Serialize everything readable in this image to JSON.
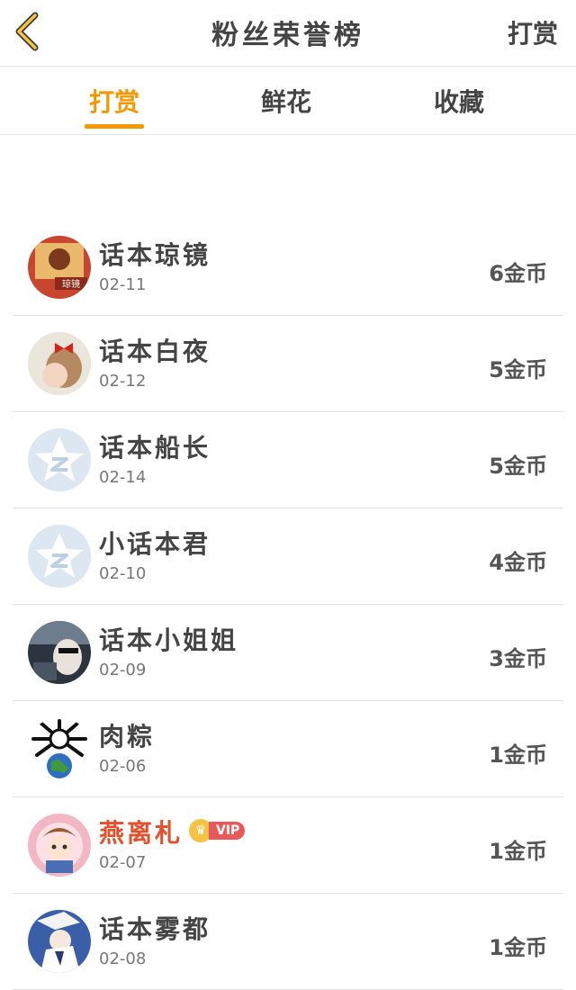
{
  "header": {
    "title": "粉丝荣誉榜",
    "right_action": "打赏",
    "back_icon": "chevron-left-icon",
    "accent": "#f39800"
  },
  "tabs": [
    {
      "label": "打赏",
      "active": true
    },
    {
      "label": "鲜花",
      "active": false
    },
    {
      "label": "收藏",
      "active": false
    }
  ],
  "list": [
    {
      "name": "话本琼镜",
      "date": "02-11",
      "amount": "6金币",
      "avatar": "book-cover-avatar"
    },
    {
      "name": "话本白夜",
      "date": "02-12",
      "amount": "5金币",
      "avatar": "girl-photo-avatar"
    },
    {
      "name": "话本船长",
      "date": "02-14",
      "amount": "5金币",
      "avatar": "default-qzone-avatar"
    },
    {
      "name": "小话本君",
      "date": "02-10",
      "amount": "4金币",
      "avatar": "default-qzone-avatar"
    },
    {
      "name": "话本小姐姐",
      "date": "02-09",
      "amount": "3金币",
      "avatar": "car-photo-avatar"
    },
    {
      "name": "肉粽",
      "date": "02-06",
      "amount": "1金币",
      "avatar": "cartoon-earth-avatar"
    },
    {
      "name": "燕离札",
      "date": "02-07",
      "amount": "1金币",
      "avatar": "cartoon-boy-avatar",
      "vip": "VIP"
    },
    {
      "name": "话本雾都",
      "date": "02-08",
      "amount": "1金币",
      "avatar": "anime-figure-avatar"
    }
  ]
}
